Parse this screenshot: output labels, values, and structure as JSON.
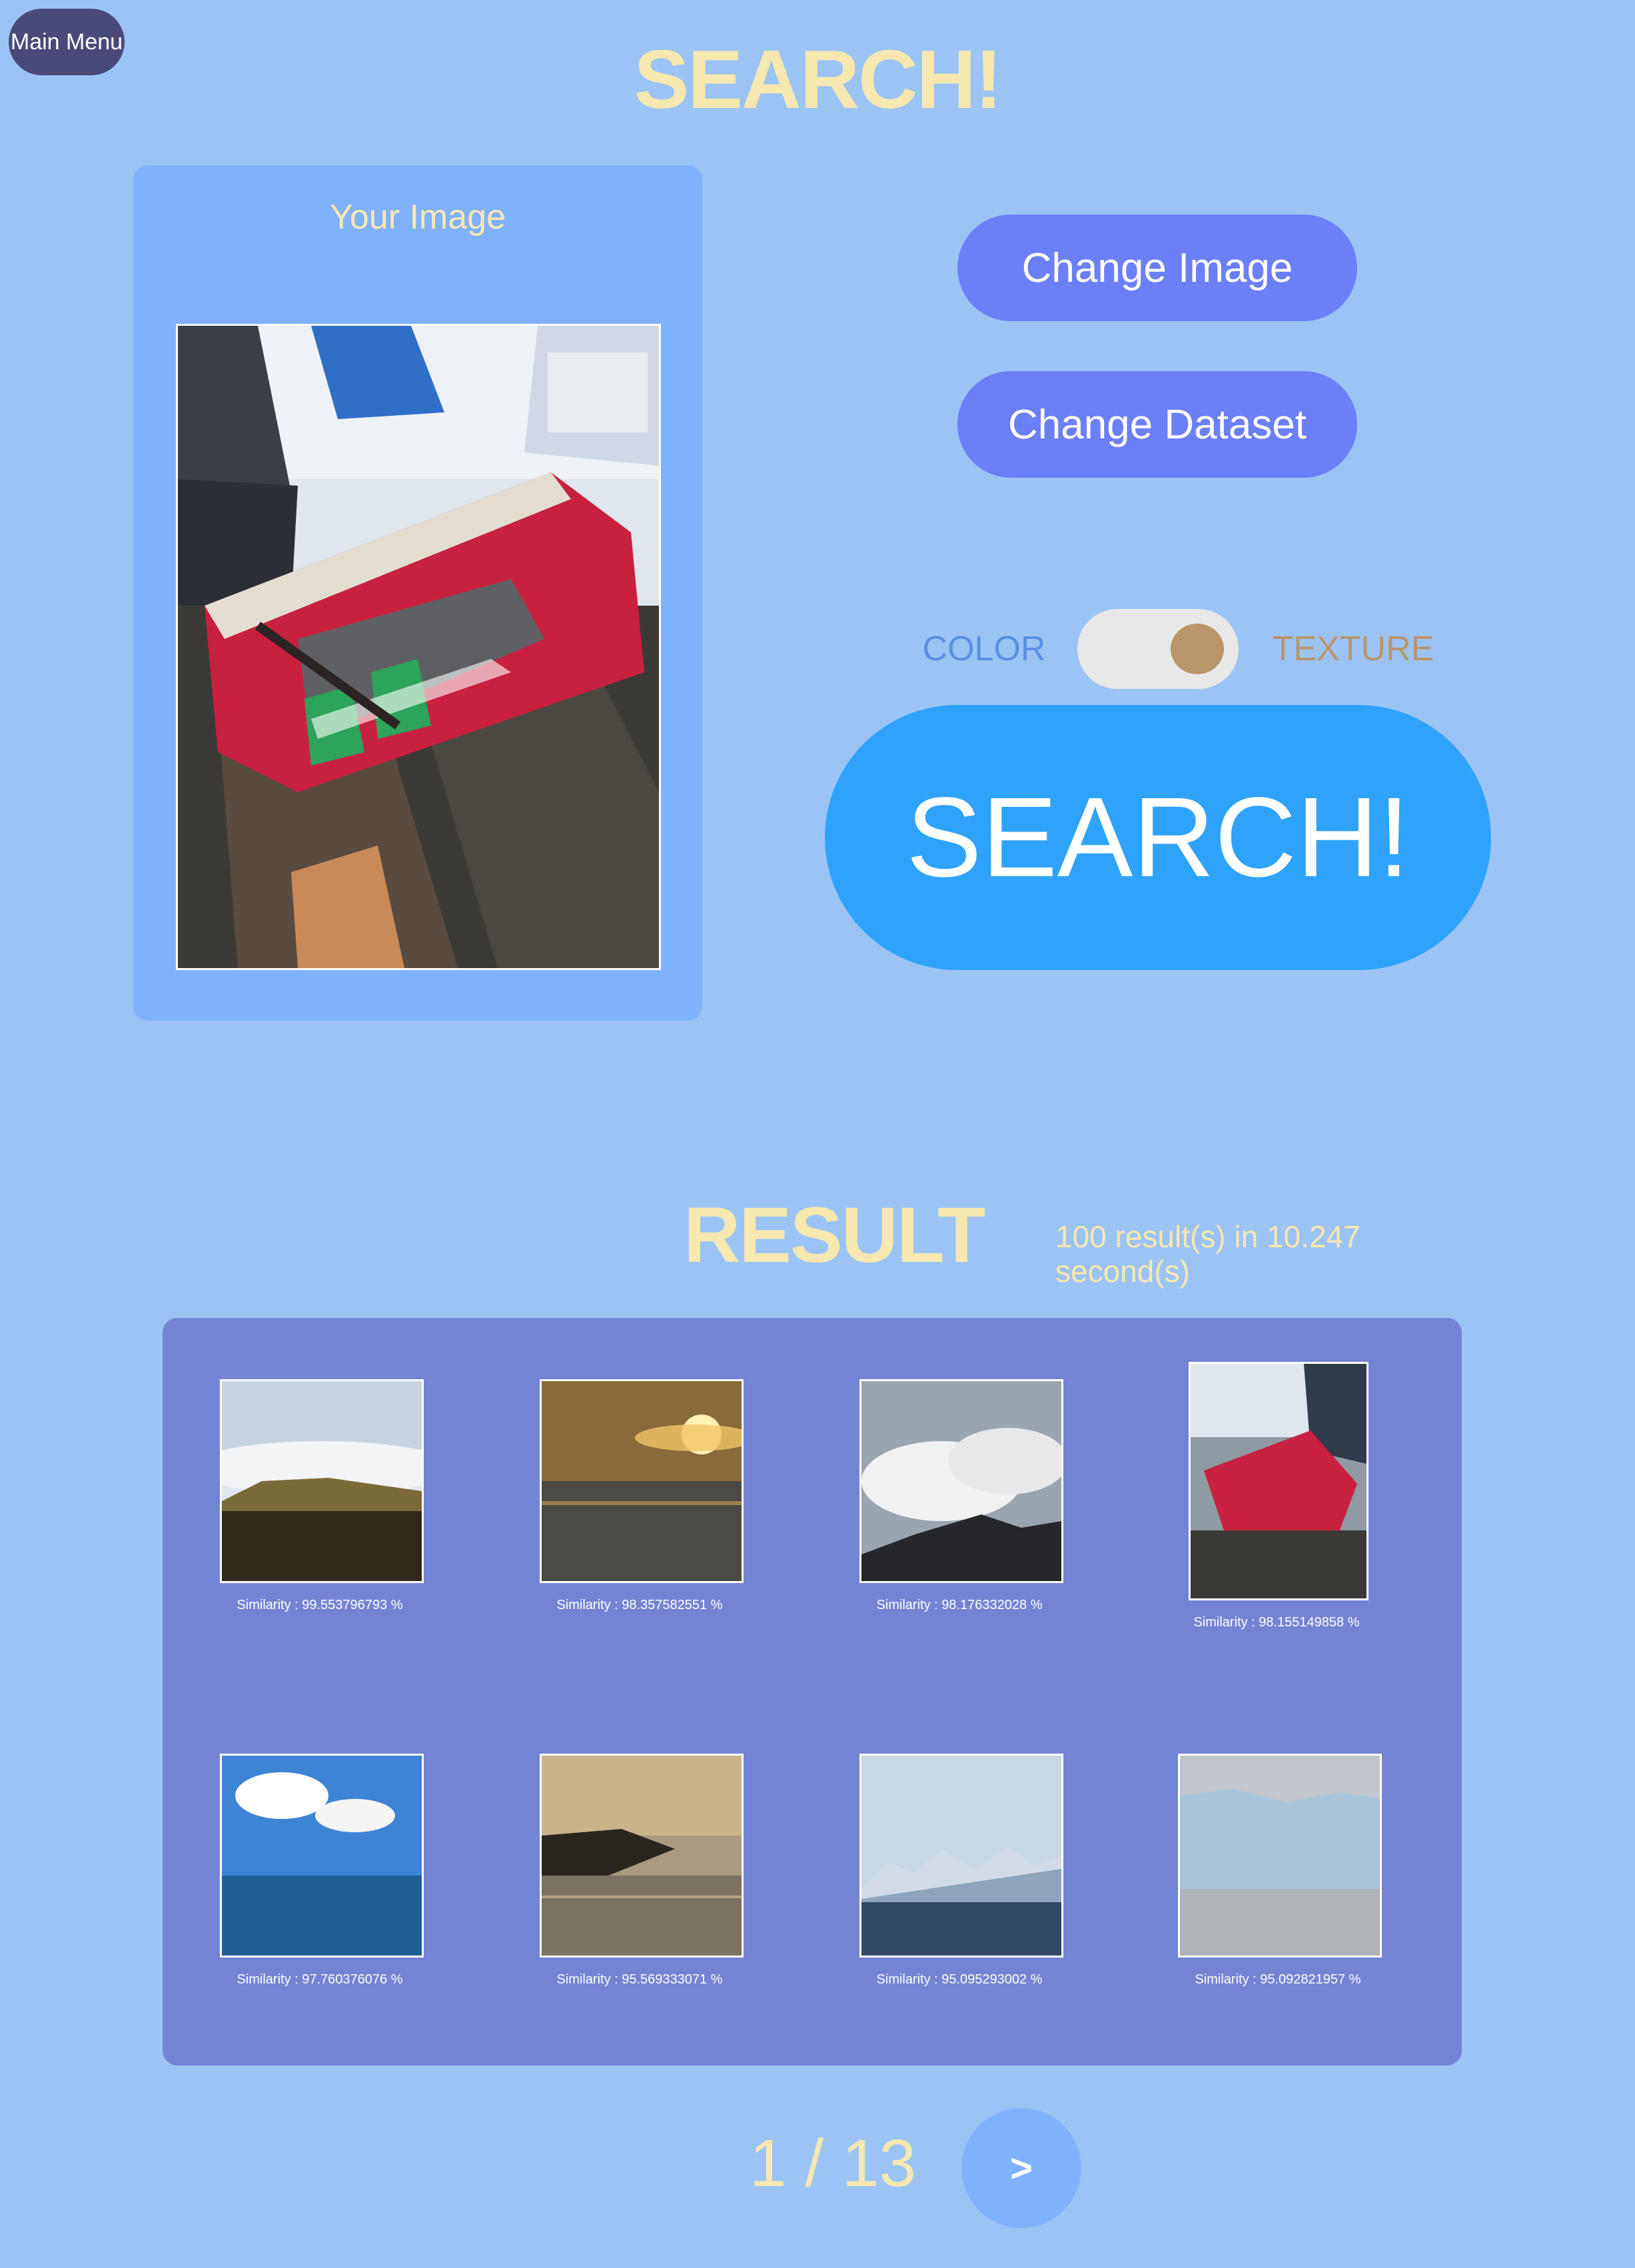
{
  "nav": {
    "main_menu_label": "Main Menu"
  },
  "header": {
    "title": "SEARCH!"
  },
  "query_panel": {
    "title": "Your Image"
  },
  "actions": {
    "change_image_label": "Change Image",
    "change_dataset_label": "Change Dataset",
    "search_label": "SEARCH!"
  },
  "mode_toggle": {
    "left_label": "COLOR",
    "right_label": "TEXTURE",
    "selected": "TEXTURE"
  },
  "results": {
    "title": "RESULT",
    "stats": "100 result(s) in 10.247 second(s)",
    "items": [
      {
        "similarity": "Similarity : 99.553796793 %"
      },
      {
        "similarity": "Similarity : 98.357582551 %"
      },
      {
        "similarity": "Similarity : 98.176332028 %"
      },
      {
        "similarity": "Similarity : 98.155149858 %"
      },
      {
        "similarity": "Similarity : 97.760376076 %"
      },
      {
        "similarity": "Similarity : 95.569333071 %"
      },
      {
        "similarity": "Similarity : 95.095293002 %"
      },
      {
        "similarity": "Similarity : 95.092821957 %"
      }
    ]
  },
  "pagination": {
    "indicator": "1 / 13",
    "next_label": ">"
  },
  "colors": {
    "background": "#9bc4f5",
    "title": "#f7e8b0",
    "panel": "#80b1fc",
    "results_panel": "#7484d4",
    "button": "#6b7ff7",
    "search_button": "#2fa3fb",
    "toggle_knob": "#b8956a"
  }
}
